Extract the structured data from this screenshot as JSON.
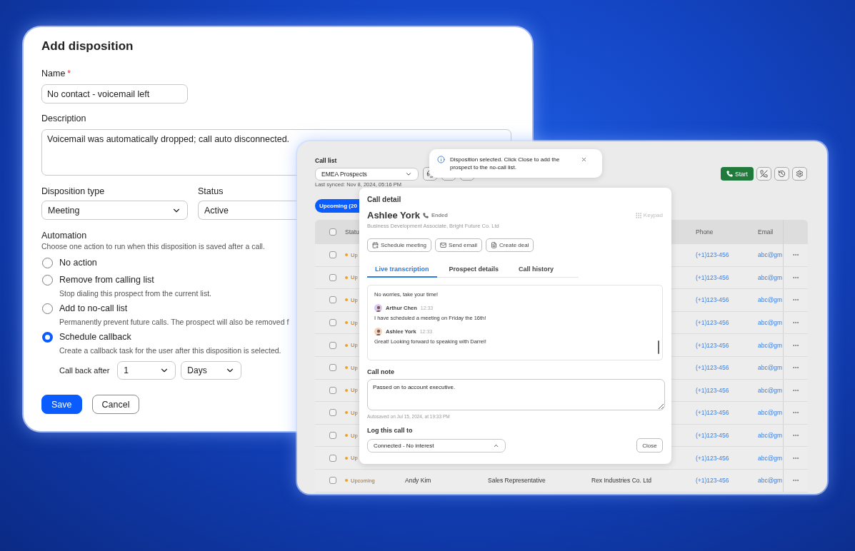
{
  "disposition_form": {
    "title": "Add disposition",
    "name": {
      "label": "Name",
      "required_mark": "*",
      "value": "No contact - voicemail left"
    },
    "description": {
      "label": "Description",
      "value": "Voicemail was automatically dropped; call auto disconnected."
    },
    "disposition_type": {
      "label": "Disposition type",
      "value": "Meeting"
    },
    "status": {
      "label": "Status",
      "value": "Active"
    },
    "automation": {
      "label": "Automation",
      "hint": "Choose one action to run when this disposition is saved after a call.",
      "options": [
        {
          "label": "No action",
          "selected": false
        },
        {
          "label": "Remove from calling list",
          "description": "Stop dialing this prospect from the current list.",
          "selected": false
        },
        {
          "label": "Add to no-call list",
          "description": "Permanently prevent future calls. The prospect will also be removed f",
          "selected": false
        },
        {
          "label": "Schedule callback",
          "description": "Create a callback task for the user after this disposition is selected.",
          "selected": true,
          "callback": {
            "label": "Call back after",
            "amount": "1",
            "unit": "Days"
          }
        }
      ]
    },
    "buttons": [
      {
        "label": "Save",
        "kind": "primary"
      },
      {
        "label": "Cancel",
        "kind": "secondary"
      }
    ]
  },
  "call_list": {
    "label": "Call list",
    "list_select": "EMEA Prospects",
    "last_synced": "Last synced: Nov 8, 2024, 05:16 PM",
    "start_button": "Start",
    "tab": {
      "label": "Upcoming (20",
      "selected": true
    },
    "table": {
      "select_all_checked": false,
      "columns": {
        "status": "Statu",
        "phone": "Phone",
        "email": "Email"
      },
      "rows": [
        {
          "checked": false,
          "status": "Up",
          "phone": "(+1)123-456",
          "email": "abc@gm"
        },
        {
          "checked": false,
          "status": "Up",
          "phone": "(+1)123-456",
          "email": "abc@gm"
        },
        {
          "checked": false,
          "status": "Up",
          "phone": "(+1)123-456",
          "email": "abc@gm"
        },
        {
          "checked": false,
          "status": "Up",
          "phone": "(+1)123-456",
          "email": "abc@gm"
        },
        {
          "checked": false,
          "status": "Up",
          "phone": "(+1)123-456",
          "email": "abc@gm"
        },
        {
          "checked": false,
          "status": "Up",
          "phone": "(+1)123-456",
          "email": "abc@gm"
        },
        {
          "checked": false,
          "status": "Up",
          "phone": "(+1)123-456",
          "email": "abc@gm"
        },
        {
          "checked": false,
          "status": "Up",
          "phone": "(+1)123-456",
          "email": "abc@gm"
        },
        {
          "checked": false,
          "status": "Up",
          "phone": "(+1)123-456",
          "email": "abc@gm"
        },
        {
          "checked": false,
          "status": "Up",
          "phone": "(+1)123-456",
          "email": "abc@gm"
        },
        {
          "checked": false,
          "status": "Upcoming",
          "column_3": "Andy Kim",
          "column_4": "Sales Representative",
          "column_5": "Rex Industries Co. Ltd",
          "phone": "(+1)123-456",
          "email": "abc@gm"
        }
      ]
    }
  },
  "toast": {
    "message": "Disposition selected. Click Close to add the prospect to the no-call list."
  },
  "call_detail": {
    "title": "Call detail",
    "contact": {
      "name": "Ashlee York",
      "call_status": "Ended",
      "subtitle": "Business Development Associate, Bright Future Co. Ltd"
    },
    "keypad": "Keypad",
    "actions": [
      {
        "label": "Schedule meeting",
        "kind": "meeting"
      },
      {
        "label": "Send email",
        "kind": "email"
      },
      {
        "label": "Create deal",
        "kind": "deal"
      }
    ],
    "tabs": [
      {
        "label": "Live transcription",
        "selected": true
      },
      {
        "label": "Prospect details",
        "selected": false
      },
      {
        "label": "Call history",
        "selected": false
      }
    ],
    "transcript": [
      {
        "text": "No worries, take your time!"
      },
      {
        "speaker": "Arthur Chen",
        "time": "12:33",
        "color": "#d9c8f2",
        "text": "I have scheduled a meeting on Friday the 16th!"
      },
      {
        "speaker": "Ashlee York",
        "time": "12:33",
        "color": "#f2d3bf",
        "text": "Great! Looking forward to speaking with Darrel!"
      }
    ],
    "call_note": {
      "label": "Call note",
      "value": "Passed on to account executive.",
      "autosaved": "Autosaved on Jul 15, 2024, at 19:33 PM"
    },
    "log": {
      "label": "Log this call to",
      "value": "Connected - No interest"
    },
    "close_button": "Close"
  }
}
